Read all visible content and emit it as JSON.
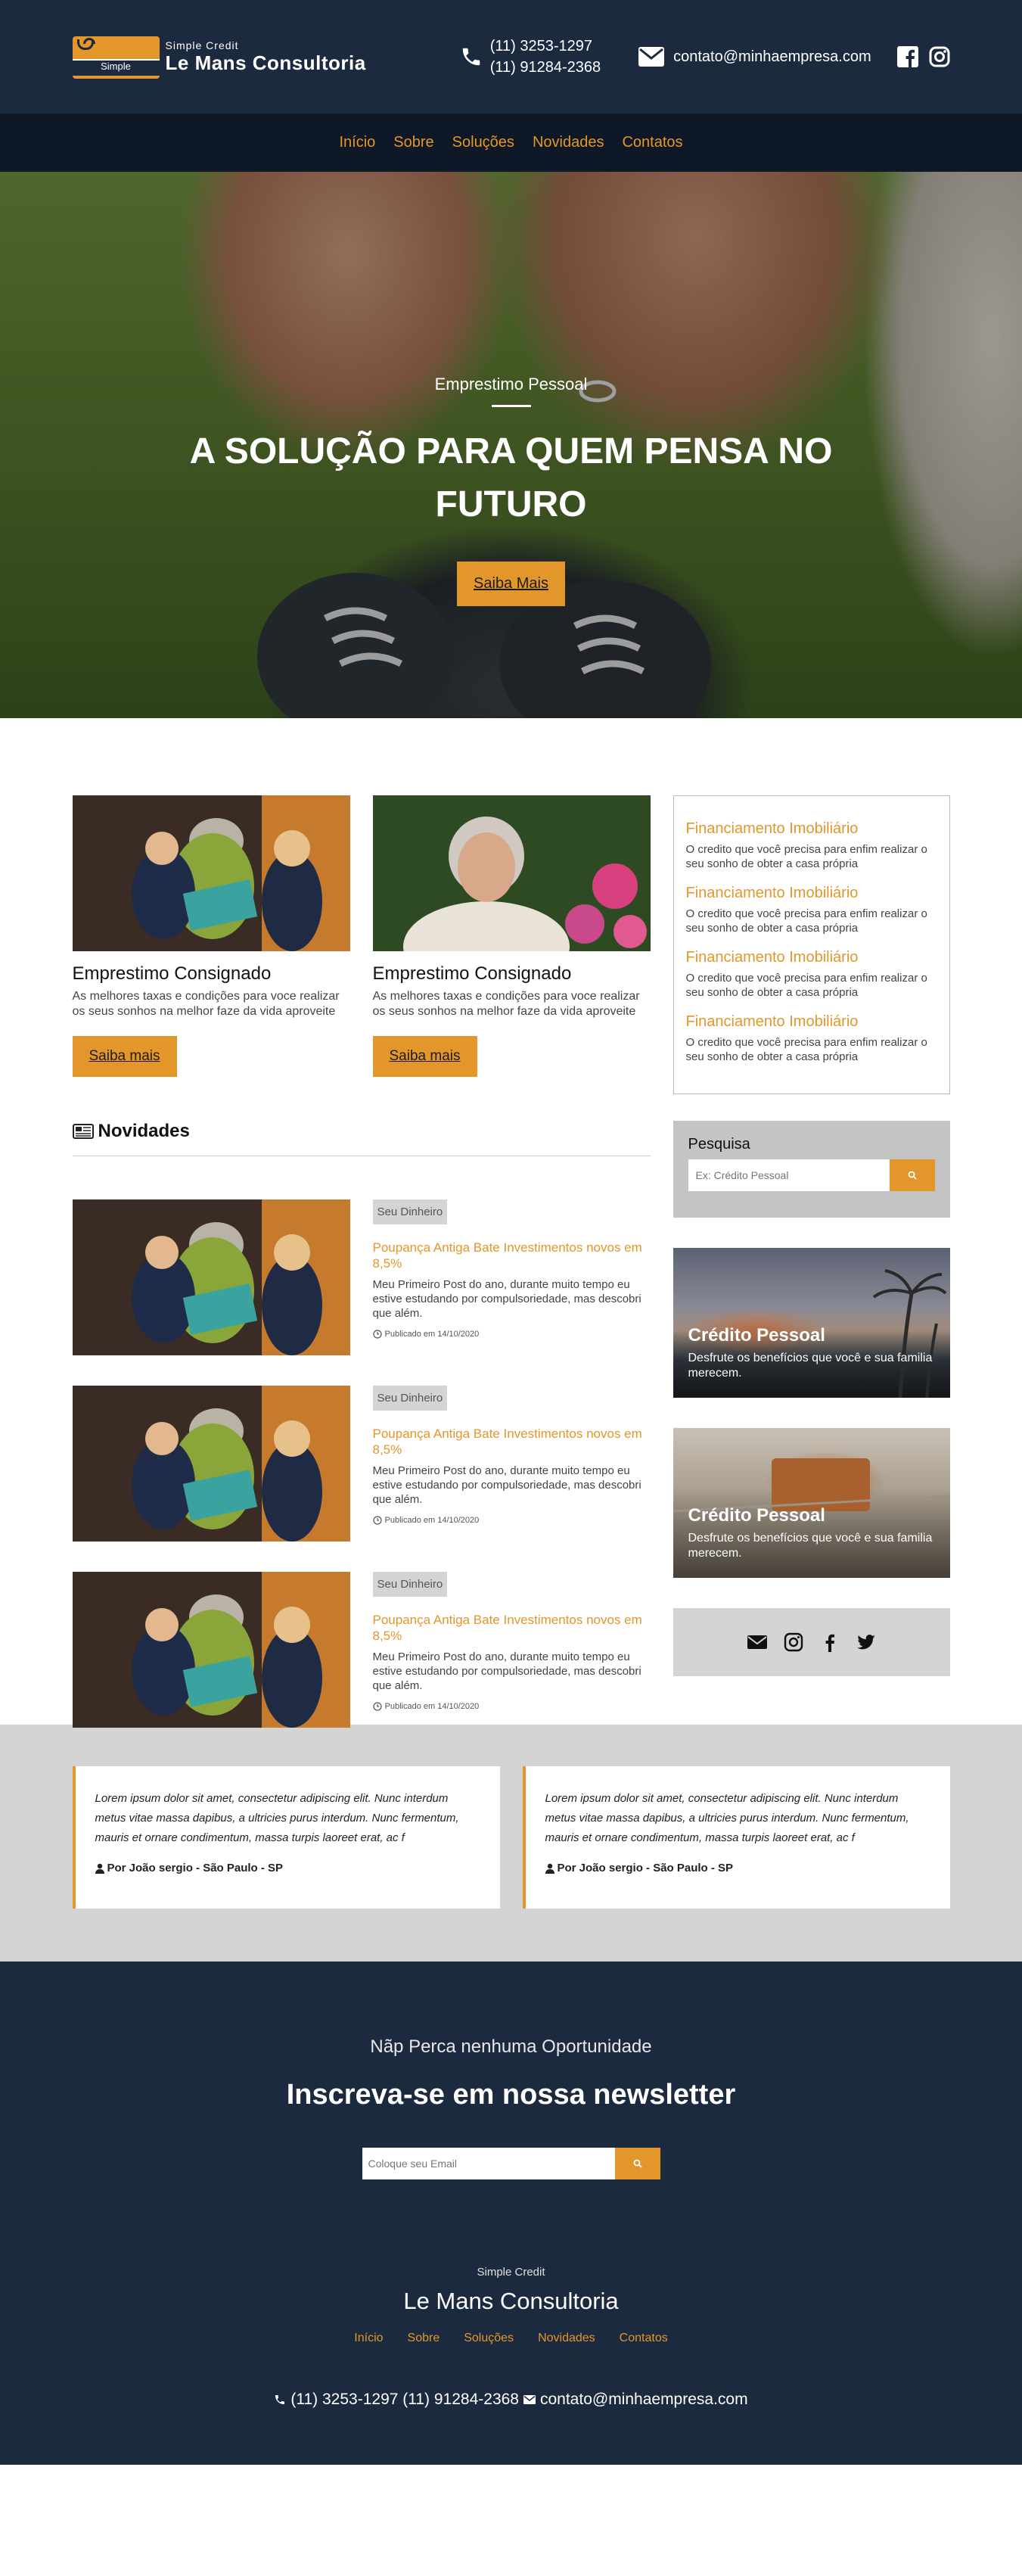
{
  "header": {
    "logo_badge_text": "Simple",
    "brand_small": "Simple Credit",
    "brand_name": "Le Mans Consultoria",
    "phone_1": "(11) 3253-1297",
    "phone_2": "(11) 91284-2368",
    "email": "contato@minhaempresa.com",
    "social_icons": [
      "facebook-icon",
      "instagram-icon"
    ]
  },
  "nav": {
    "items": [
      "Início",
      "Sobre",
      "Soluções",
      "Novidades",
      "Contatos"
    ]
  },
  "hero": {
    "subtitle": "Emprestimo Pessoal",
    "title": "A SOLUÇÃO PARA QUEM PENSA NO FUTURO",
    "button": "Saiba Mais"
  },
  "services": {
    "cards": [
      {
        "title": "Emprestimo Consignado",
        "text": "As melhores taxas e condições para voce realizar os seus sonhos na melhor faze da vida aproveite",
        "button": "Saiba mais"
      },
      {
        "title": "Emprestimo Consignado",
        "text": "As melhores taxas e condições para voce realizar os seus sonhos na melhor faze da vida aproveite",
        "button": "Saiba mais"
      }
    ],
    "financing": [
      {
        "title": "Financiamento Imobiliário",
        "text": "O credito que você precisa para enfim realizar o seu sonho de obter a casa própria"
      },
      {
        "title": "Financiamento Imobiliário",
        "text": "O credito que você precisa para enfim realizar o seu sonho de obter a casa própria"
      },
      {
        "title": "Financiamento Imobiliário",
        "text": "O credito que você precisa para enfim realizar o seu sonho de obter a casa própria"
      },
      {
        "title": "Financiamento Imobiliário",
        "text": "O credito que você precisa para enfim realizar o seu sonho de obter a casa própria"
      }
    ]
  },
  "news": {
    "heading": "Novidades",
    "posts": [
      {
        "tag": "Seu Dinheiro",
        "title": "Poupança Antiga Bate Investimentos novos em 8,5%",
        "text": "Meu Primeiro Post do ano, durante muito tempo eu estive estudando por compulsoriedade, mas descobri que além.",
        "date": "Publicado em 14/10/2020"
      },
      {
        "tag": "Seu Dinheiro",
        "title": "Poupança Antiga Bate Investimentos novos em 8,5%",
        "text": "Meu Primeiro Post do ano, durante muito tempo eu estive estudando por compulsoriedade, mas descobri que além.",
        "date": "Publicado em 14/10/2020"
      },
      {
        "tag": "Seu Dinheiro",
        "title": "Poupança Antiga Bate Investimentos novos em 8,5%",
        "text": "Meu Primeiro Post do ano, durante muito tempo eu estive estudando por compulsoriedade, mas descobri que além.",
        "date": "Publicado em 14/10/2020"
      }
    ]
  },
  "sidebar": {
    "search_label": "Pesquisa",
    "search_placeholder": "Ex: Crédito Pessoal",
    "promos": [
      {
        "title": "Crédito Pessoal",
        "text": "Desfrute os benefícios que você e sua familia merecem."
      },
      {
        "title": "Crédito Pessoal",
        "text": "Desfrute os benefícios que você e sua familia merecem."
      }
    ],
    "social_icons": [
      "envelope-icon",
      "instagram-icon",
      "facebook-icon",
      "twitter-icon"
    ]
  },
  "testimonials": [
    {
      "text": "Lorem ipsum dolor sit amet, consectetur adipiscing elit. Nunc interdum metus vitae massa dapibus, a ultricies purus interdum. Nunc fermentum, mauris et ornare condimentum, massa turpis laoreet erat, ac f",
      "author": "Por João sergio - São Paulo - SP"
    },
    {
      "text": "Lorem ipsum dolor sit amet, consectetur adipiscing elit. Nunc interdum metus vitae massa dapibus, a ultricies purus interdum. Nunc fermentum, mauris et ornare condimentum, massa turpis laoreet erat, ac f",
      "author": "Por João sergio - São Paulo - SP"
    }
  ],
  "newsletter": {
    "subtitle": "Nãp Perca nenhuma Oportunidade",
    "title": "Inscreva-se em nossa newsletter",
    "placeholder": "Coloque seu Email"
  },
  "footer": {
    "brand_small": "Simple Credit",
    "brand_name": "Le Mans Consultoria",
    "nav": [
      "Início",
      "Sobre",
      "Soluções",
      "Novidades",
      "Contatos"
    ],
    "phones": "(11) 3253-1297 (11) 91284-2368",
    "email": "contato@minhaempresa.com"
  },
  "colors": {
    "navy": "#1c2a3f",
    "nav_dark": "#0f1826",
    "accent": "#e3962a",
    "gray_panel": "#d4d4d4"
  }
}
